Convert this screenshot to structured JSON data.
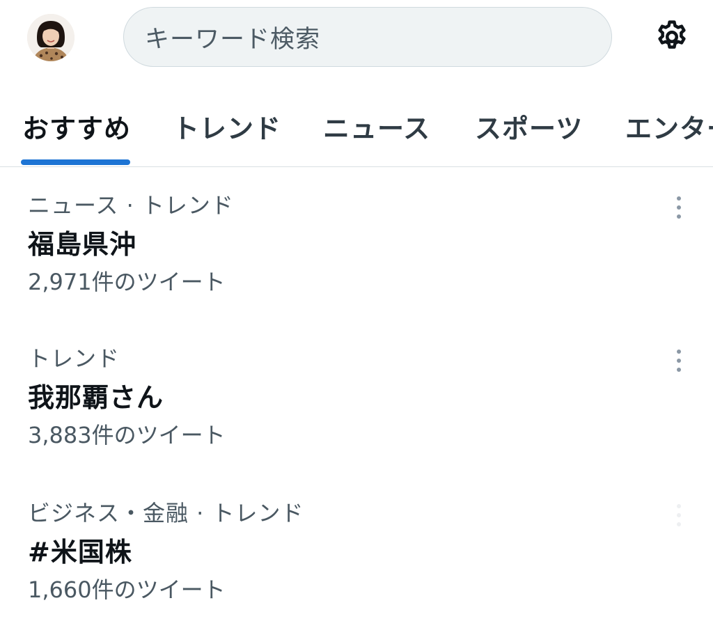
{
  "header": {
    "avatar_icon": "user-avatar-photo",
    "search_placeholder": "キーワード検索",
    "settings_icon": "gear-icon"
  },
  "tabs": [
    {
      "label": "おすすめ",
      "active": true
    },
    {
      "label": "トレンド",
      "active": false
    },
    {
      "label": "ニュース",
      "active": false
    },
    {
      "label": "スポーツ",
      "active": false
    },
    {
      "label": "エンター",
      "active": false
    }
  ],
  "accent_color": "#1d74d4",
  "trends": [
    {
      "category": "ニュース · トレンド",
      "title": "福島県沖",
      "count": "2,971件のツイート"
    },
    {
      "category": "トレンド",
      "title": "我那覇さん",
      "count": "3,883件のツイート"
    },
    {
      "category": "ビジネス・金融 · トレンド",
      "title": "#米国株",
      "count": "1,660件のツイート"
    }
  ]
}
